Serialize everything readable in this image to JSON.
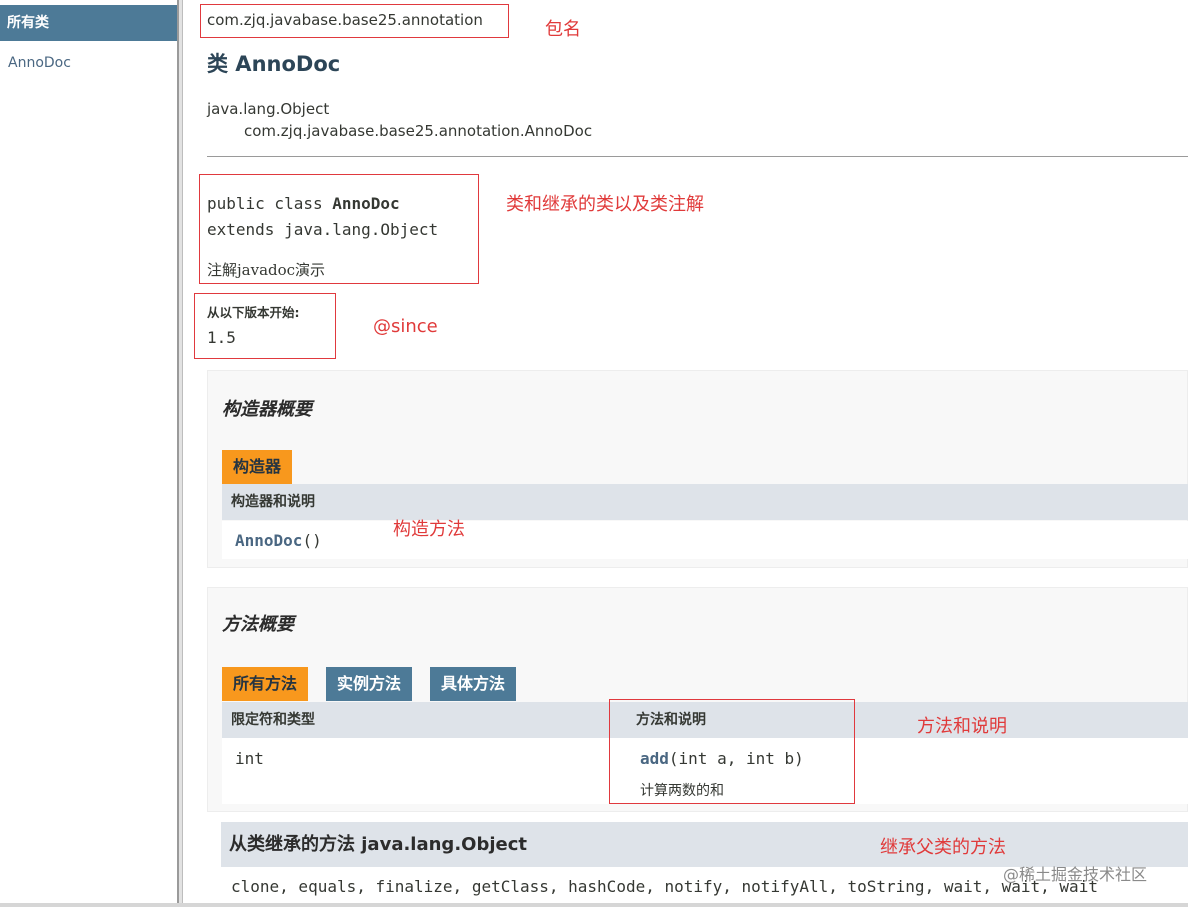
{
  "left_frame": {
    "header": "所有类",
    "items": [
      "AnnoDoc"
    ]
  },
  "header": {
    "package": "com.zjq.javabase.base25.annotation",
    "class_title": "类 AnnoDoc"
  },
  "inheritance": {
    "parent": "java.lang.Object",
    "child": "com.zjq.javabase.base25.annotation.AnnoDoc"
  },
  "declaration": {
    "line1_prefix": "public class ",
    "line1_name": "AnnoDoc",
    "line2": "extends java.lang.Object",
    "description": "注解javadoc演示"
  },
  "since": {
    "label": "从以下版本开始:",
    "value": "1.5"
  },
  "constructor_summary": {
    "title": "构造器概要",
    "tab": "构造器",
    "column": "构造器和说明",
    "rows": [
      {
        "name": "AnnoDoc",
        "params": "()"
      }
    ]
  },
  "method_summary": {
    "title": "方法概要",
    "tabs": [
      "所有方法",
      "实例方法",
      "具体方法"
    ],
    "columns": [
      "限定符和类型",
      "方法和说明"
    ],
    "rows": [
      {
        "type": "int",
        "name": "add",
        "params": "(int a, int b)",
        "description": "计算两数的和"
      }
    ]
  },
  "inherited": {
    "title": "从类继承的方法 java.lang.Object",
    "methods": "clone, equals, finalize, getClass, hashCode, notify, notifyAll, toString, wait, wait, wait"
  },
  "annotations": {
    "package": "包名",
    "class": "类和继承的类以及类注解",
    "since": "@since",
    "constructor": "构造方法",
    "method": "方法和说明",
    "inherited": "继承父类的方法"
  },
  "watermark": "@稀土掘金技术社区"
}
